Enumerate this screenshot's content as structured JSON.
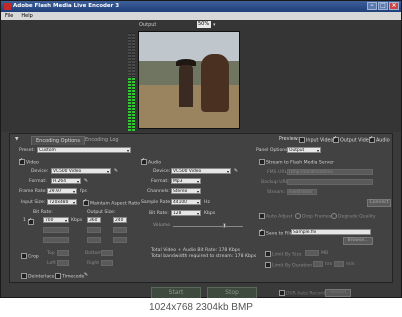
{
  "window": {
    "title": "Adobe Flash Media Live Encoder 3"
  },
  "menu": {
    "file": "File",
    "help": "Help"
  },
  "preview_top": {
    "output_label": "Output",
    "zoom": "50%"
  },
  "audio_meter_levels": {
    "left": 0.55,
    "right": 0.55
  },
  "tabs": {
    "encoding": "Encoding Options",
    "log": "Encoding Log"
  },
  "preview_opts": {
    "label": "Preview:",
    "input_video": "Input Video",
    "output_video": "Output Video",
    "audio": "Audio"
  },
  "preset": {
    "label": "Preset:",
    "value": "Custom"
  },
  "panel_options": {
    "label": "Panel Options:",
    "value": "Output"
  },
  "video": {
    "label": "Video",
    "device_label": "Device:",
    "device": "VC500 Video",
    "format_label": "Format:",
    "format": "H.264",
    "frame_rate_label": "Frame Rate:",
    "frame_rate": "29.97",
    "fps": "fps",
    "input_size_label": "Input Size:",
    "input_size": "720x480",
    "maintain": "Maintain Aspect Ratio",
    "bit_rate_label": "Bit Rate:",
    "output_size_label": "Output Size:",
    "bitrate1": "700",
    "kbps": "Kbps",
    "out_w": "360",
    "out_h": "240",
    "crop": "Crop",
    "top": "Top",
    "bottom": "Bottom",
    "left": "Left",
    "right": "Right",
    "deinterlace": "Deinterlace",
    "timecode": "Timecode"
  },
  "audio": {
    "label": "Audio",
    "device_label": "Device:",
    "device": "VC500 Video",
    "format_label": "Format:",
    "format": "Mp3",
    "channels_label": "Channels:",
    "channels": "Stereo",
    "sample_rate_label": "Sample Rate:",
    "sample_rate": "44100",
    "hz": "Hz",
    "bit_rate_label": "Bit Rate:",
    "bit_rate": "128",
    "kbps": "Kbps",
    "volume": "Volume",
    "total1": "Total Video  +  Audio Bit Rate:  178 Kbps",
    "total2": "Total bandwidth required to stream:  178 Kbps"
  },
  "stream": {
    "label": "Stream to Flash Media Server",
    "fms_url": "FMS URL:",
    "fms_value": "rtmp://localhost/live",
    "backup": "Backup URL:",
    "stream_label": "Stream:",
    "stream_value": "livestream",
    "connect": "Connect",
    "auto_adjust": "Auto Adjust",
    "drop_frames": "Drop Frames",
    "degrade": "Degrade Quality",
    "save": "Save to File",
    "save_value": "Sample.flv",
    "browse": "Browse...",
    "limit_size": "Limit By Size",
    "mb": "MB",
    "limit_duration": "Limit By Duration",
    "hrs": "hrs",
    "min": "min"
  },
  "footer": {
    "start": "Start",
    "stop": "Stop",
    "dvr": "DVR Auto Record",
    "record": "Record"
  },
  "caption": "1024x768 2304kb BMP"
}
